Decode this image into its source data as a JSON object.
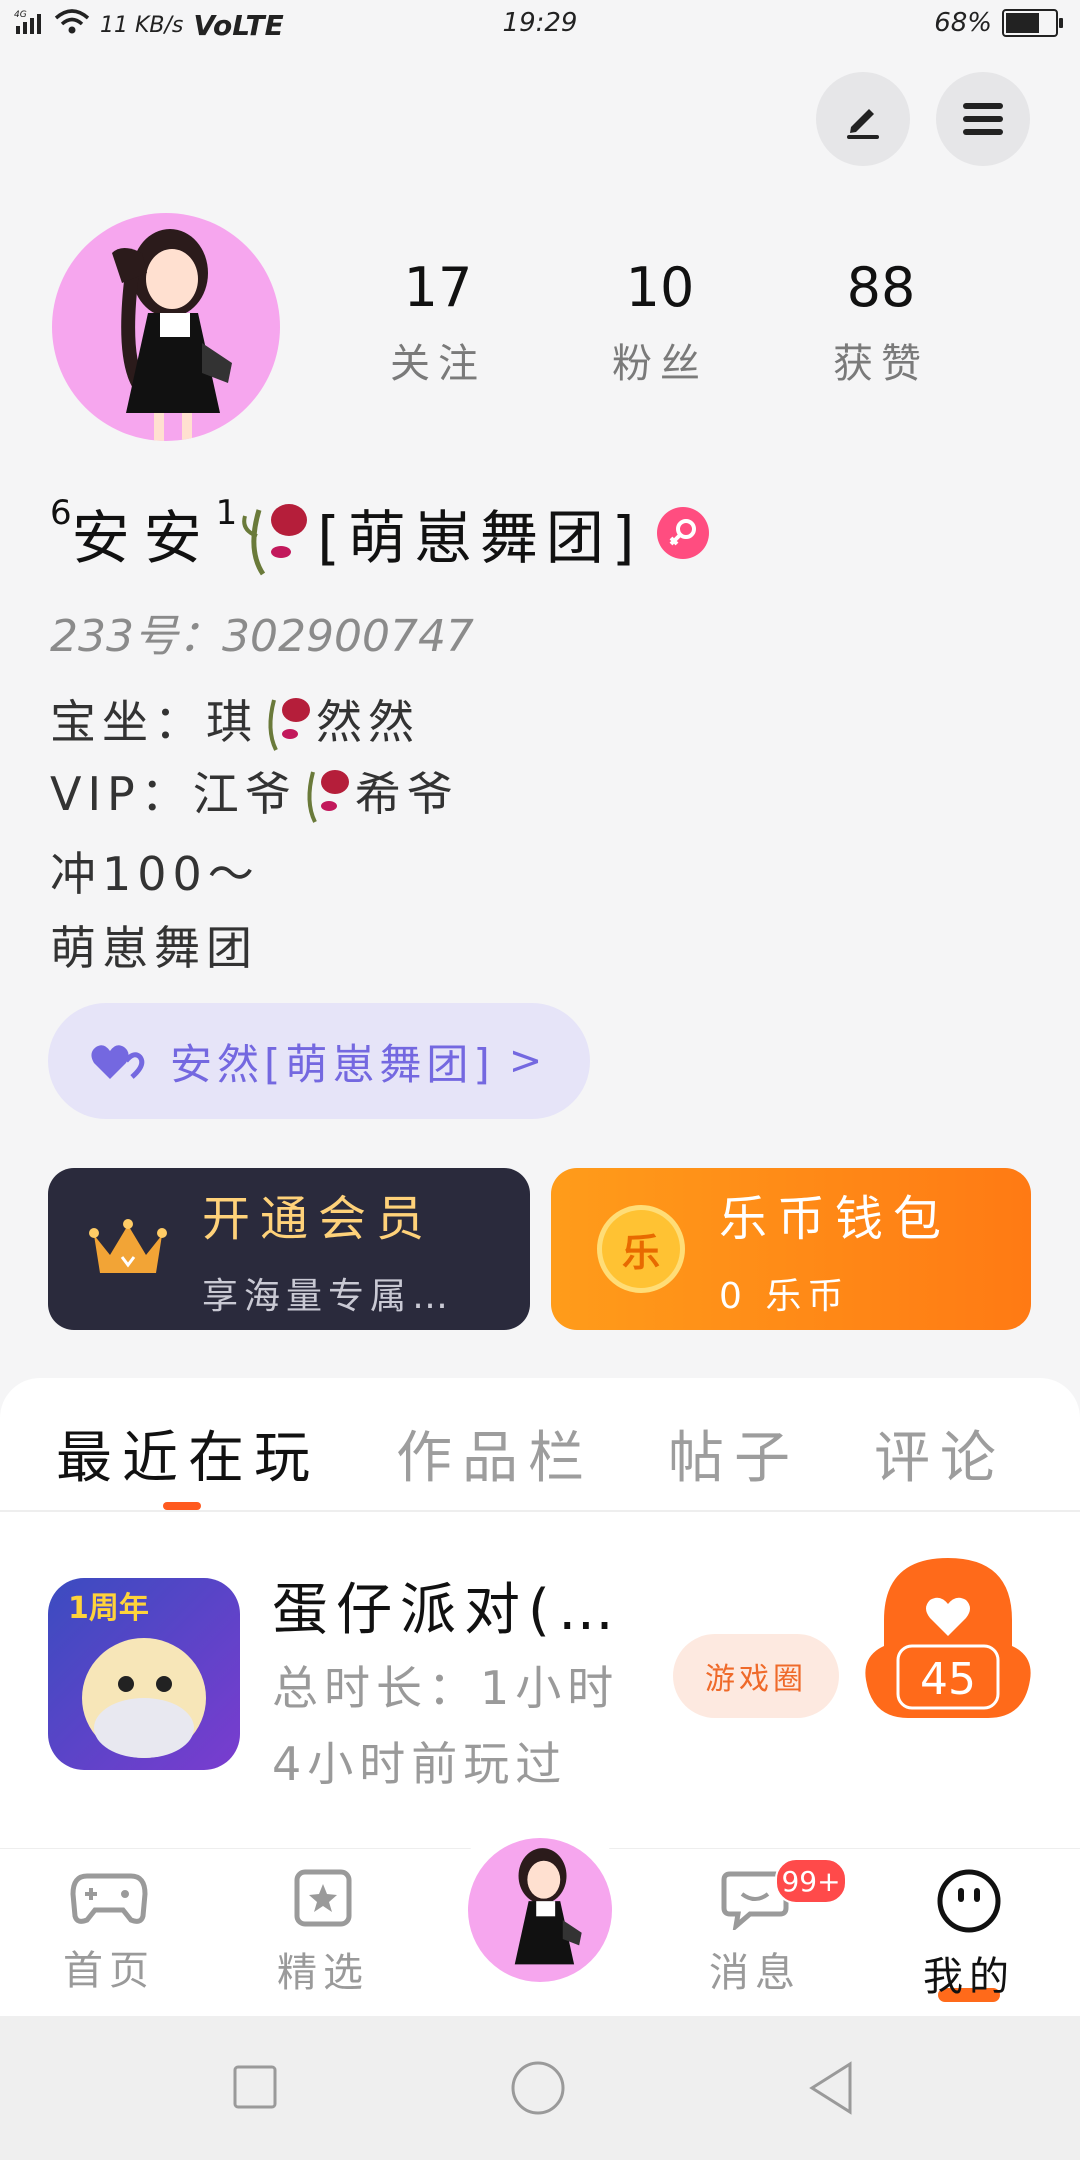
{
  "status_bar": {
    "network": "4G",
    "speed": "11 KB/s",
    "volte": "VoLTE",
    "time": "19:29",
    "battery_percent": "68%",
    "battery_level": 0.68
  },
  "header": {
    "edit_icon": "pencil-icon",
    "menu_icon": "hamburger-icon"
  },
  "profile": {
    "stats": [
      {
        "value": "17",
        "label": "关注"
      },
      {
        "value": "10",
        "label": "粉丝"
      },
      {
        "value": "88",
        "label": "获赞"
      }
    ],
    "nickname_prefix_sup": "6",
    "nickname_main": "安安",
    "nickname_mid_sup": "1",
    "nickname_suffix": "[萌崽舞团]",
    "gender_icon": "female-icon",
    "uid": "233号：302900747",
    "bio_lines": [
      {
        "before": "宝坐：琪",
        "after": "然然"
      },
      {
        "before": "VIP：江爷",
        "after": "希爷"
      }
    ],
    "bio_line3": "冲100～",
    "bio_line4": "萌崽舞团",
    "tag_text": "安然[萌崽舞团]",
    "tag_chevron": ">"
  },
  "cards": {
    "vip": {
      "title": "开通会员",
      "subtitle": "享海量专属…",
      "icon": "crown-icon"
    },
    "wallet": {
      "title": "乐币钱包",
      "subtitle": "0 乐币",
      "icon": "coin-icon",
      "coin_char": "乐"
    }
  },
  "tabs": [
    {
      "label": "最近在玩",
      "active": true
    },
    {
      "label": "作品栏",
      "active": false
    },
    {
      "label": "帖子",
      "active": false
    },
    {
      "label": "评论",
      "active": false
    }
  ],
  "recent_game": {
    "title": "蛋仔派对(…",
    "duration": "总时长：1小时",
    "last_played": "4小时前玩过",
    "icon_text": "1周年",
    "circle_button": "游戏圈",
    "likes": "45"
  },
  "bottom_nav": [
    {
      "label": "首页",
      "icon": "gamepad-icon",
      "active": false
    },
    {
      "label": "精选",
      "icon": "star-icon",
      "active": false
    },
    {
      "label": "",
      "icon": "avatar",
      "active": false
    },
    {
      "label": "消息",
      "icon": "chat-icon",
      "active": false,
      "badge": "99+"
    },
    {
      "label": "我的",
      "icon": "face-icon",
      "active": true
    }
  ],
  "colors": {
    "accent_orange": "#ff5a1f",
    "tag_purple": "#7468e0",
    "vip_card": "#2a2a3c",
    "wallet_card": "#ff8c1a",
    "badge_red": "#ff4a4a"
  }
}
